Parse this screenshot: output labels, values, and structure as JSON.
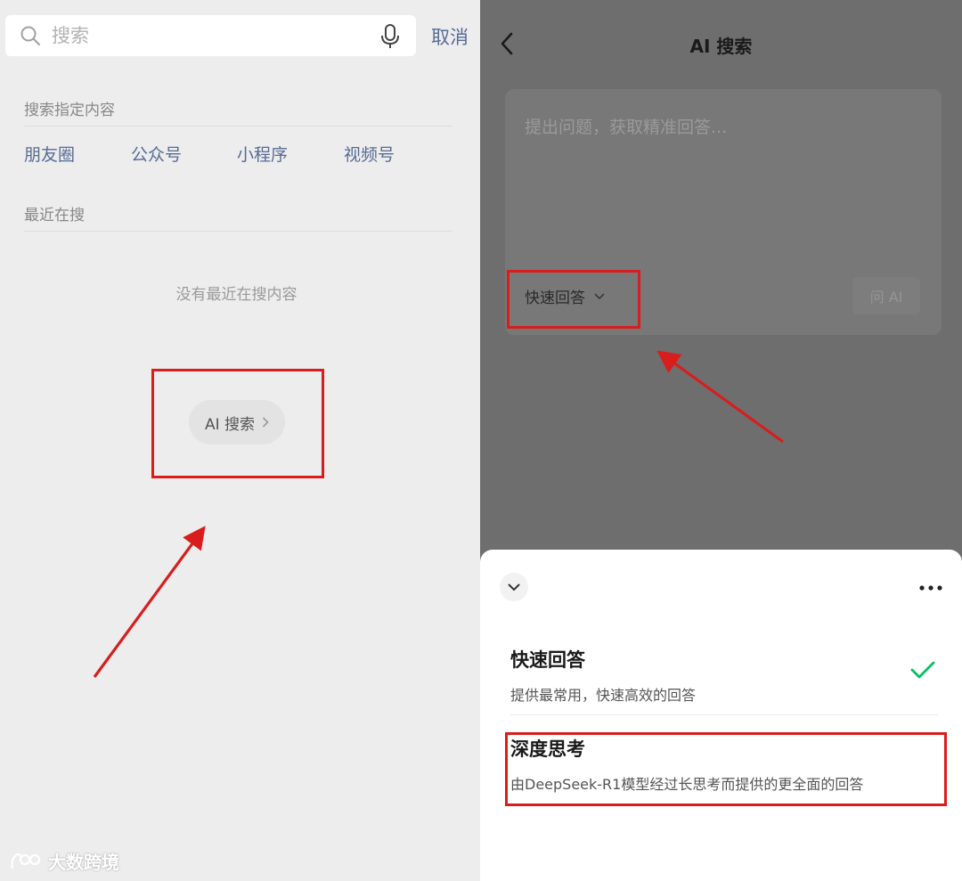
{
  "left": {
    "search": {
      "placeholder": "搜索",
      "cancel_label": "取消"
    },
    "specified_section_label": "搜索指定内容",
    "quick_links": [
      "朋友圈",
      "公众号",
      "小程序",
      "视频号"
    ],
    "recent_section_label": "最近在搜",
    "empty_text": "没有最近在搜内容",
    "ai_search_label": "AI 搜索"
  },
  "right": {
    "title": "AI 搜索",
    "question_placeholder": "提出问题，获取精准回答...",
    "mode_label": "快速回答",
    "ask_label": "问 AI",
    "sheet": {
      "options": [
        {
          "title": "快速回答",
          "desc": "提供最常用，快速高效的回答",
          "selected": true
        },
        {
          "title": "深度思考",
          "desc": "由DeepSeek-R1模型经过长思考而提供的更全面的回答",
          "selected": false
        }
      ]
    }
  },
  "watermark": "大数跨境",
  "colors": {
    "link": "#576b95",
    "highlight_red": "#d91d1d",
    "check_green": "#07c160",
    "overlay_gray": "#6e6e6e"
  },
  "icons": [
    "search-icon",
    "mic-icon",
    "chevron-right-icon",
    "back-icon",
    "chevron-down-icon",
    "more-icon",
    "check-icon",
    "arrow-annotation"
  ]
}
